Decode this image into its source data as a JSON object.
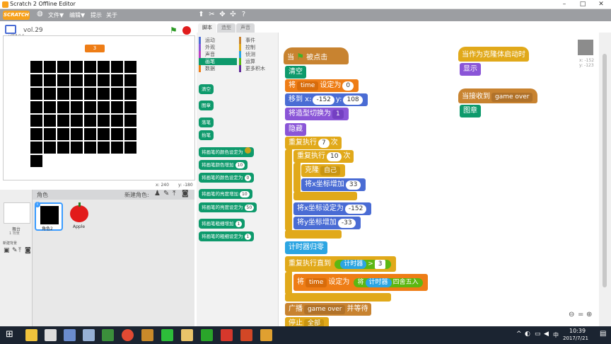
{
  "window": {
    "title": "Scratch 2 Offline Editor"
  },
  "menubar": {
    "logo": "SCRATCH",
    "items": [
      "文件▼",
      "编辑▼",
      "提示",
      "关于"
    ]
  },
  "stage": {
    "project_name": "vol.29",
    "version": "v458.0.4",
    "variable_value": "3",
    "mouse_x": "x: 240",
    "mouse_y": "y: -180"
  },
  "sprites": {
    "title": "角色",
    "new_sprite_label": "新建角色:",
    "stage_label": "舞台",
    "stage_sub": "1 背景",
    "new_backdrop_label": "新建背景",
    "items": [
      {
        "name": "角色2"
      },
      {
        "name": "Apple"
      }
    ]
  },
  "tabs": [
    "脚本",
    "造型",
    "声音"
  ],
  "categories": {
    "left": [
      {
        "label": "运动",
        "color": "#4a6cd4"
      },
      {
        "label": "外观",
        "color": "#8a55d7"
      },
      {
        "label": "声音",
        "color": "#bb42c3"
      },
      {
        "label": "画笔",
        "color": "#0e9a6c"
      },
      {
        "label": "数据",
        "color": "#ee7d16"
      }
    ],
    "right": [
      {
        "label": "事件",
        "color": "#c88330"
      },
      {
        "label": "控制",
        "color": "#e1a91a"
      },
      {
        "label": "侦测",
        "color": "#2ca5e2"
      },
      {
        "label": "运算",
        "color": "#5cb712"
      },
      {
        "label": "更多积木",
        "color": "#632d99"
      }
    ]
  },
  "palette_blocks": [
    {
      "label": "清空",
      "val": ""
    },
    {
      "label": "图章",
      "val": ""
    },
    {
      "label": "落笔",
      "val": ""
    },
    {
      "label": "抬笔",
      "val": ""
    },
    {
      "label": "将画笔的颜色设定为",
      "val": ""
    },
    {
      "label": "将画笔颜色增加",
      "val": "10"
    },
    {
      "label": "将画笔的颜色设定为",
      "val": "0"
    },
    {
      "label": "将画笔的亮度增加",
      "val": "10"
    },
    {
      "label": "将画笔的亮度设定为",
      "val": "50"
    },
    {
      "label": "将画笔粗细增加",
      "val": "1"
    },
    {
      "label": "将画笔的粗细设定为",
      "val": "1"
    }
  ],
  "script": {
    "when_flag": "当",
    "when_flag_tail": "被点击",
    "clear": "清空",
    "set_var_prefix": "将",
    "var_time": "time",
    "set_to": "设定为",
    "set_val": "0",
    "goto_label": "移到 x:",
    "goto_x": "-152",
    "goto_y_label": "y:",
    "goto_y": "108",
    "costume_label": "将造型切换为",
    "costume_val": "1",
    "hide": "隐藏",
    "repeat_label": "重复执行",
    "repeat_outer": "7",
    "repeat_tail": "次",
    "repeat_inner": "10",
    "clone_label": "克隆",
    "clone_target": "自己",
    "change_x_label": "将x坐标增加",
    "change_x_val": "33",
    "set_x_label": "将x坐标设定为",
    "set_x_val": "-152",
    "change_y_label": "将y坐标增加",
    "change_y_val": "-33",
    "reset_timer": "计时器归零",
    "repeat_until": "重复执行直到",
    "timer": "计时器",
    "gt": ">",
    "gt_val": "3",
    "round_label": "四舍五入",
    "broadcast_label": "广播",
    "broadcast_msg": "game over",
    "broadcast_tail": "并等待",
    "partial": "停止",
    "partial_val": "全部",
    "clone_start": "当作为克隆体启动时",
    "show": "显示",
    "receive_label": "当接收到",
    "receive_msg": "game over",
    "stamp": "图章"
  },
  "sprite_info": {
    "x": "x: -152",
    "y": "y: -123"
  },
  "taskbar": {
    "time": "10:39",
    "date": "2017/7/21",
    "ime": "中"
  }
}
